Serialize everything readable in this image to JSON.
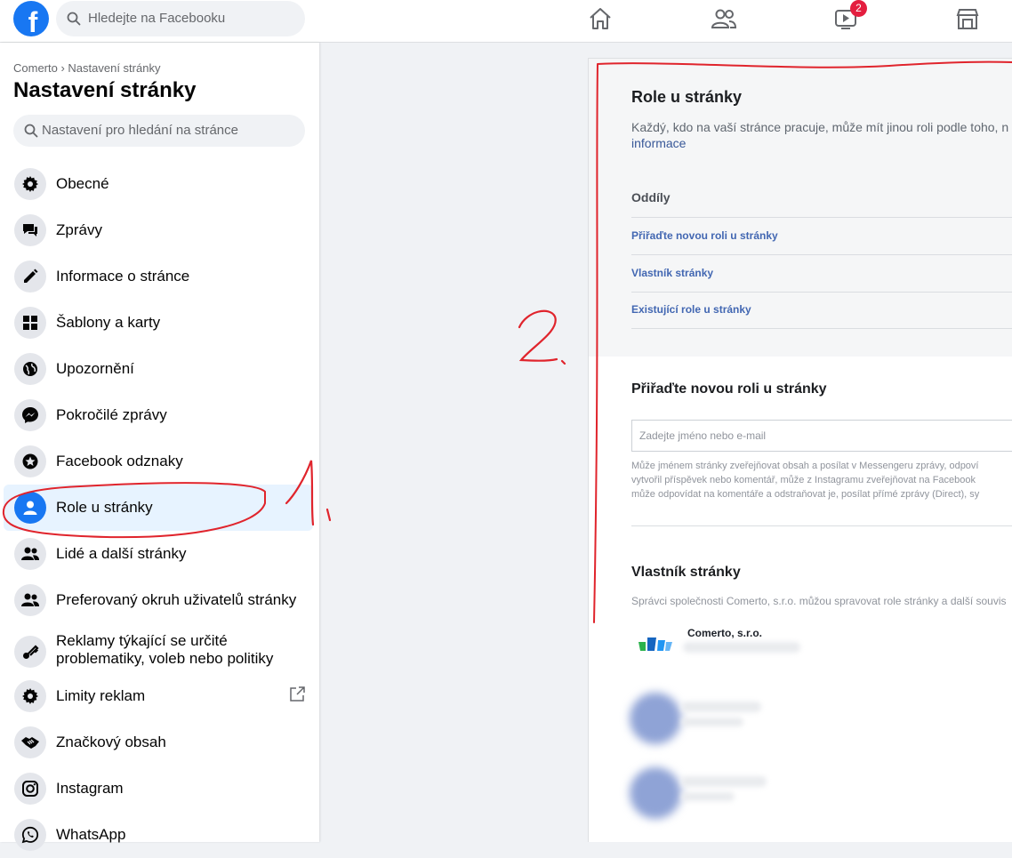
{
  "topbar": {
    "logo": "f",
    "search_placeholder": "Hledejte na Facebooku",
    "nav": [
      {
        "icon": "home-icon"
      },
      {
        "icon": "friends-icon"
      },
      {
        "icon": "watch-icon",
        "badge": "2"
      },
      {
        "icon": "marketplace-icon"
      }
    ]
  },
  "sidebar": {
    "breadcrumb": "Comerto › Nastavení stránky",
    "title": "Nastavení stránky",
    "search_placeholder": "Nastavení pro hledání na stránce",
    "items": [
      {
        "label": "Obecné",
        "icon": "gear-icon"
      },
      {
        "label": "Zprávy",
        "icon": "chat-icon"
      },
      {
        "label": "Informace o stránce",
        "icon": "pencil-icon"
      },
      {
        "label": "Šablony a karty",
        "icon": "grid-icon"
      },
      {
        "label": "Upozornění",
        "icon": "globe-icon"
      },
      {
        "label": "Pokročilé zprávy",
        "icon": "messenger-icon"
      },
      {
        "label": "Facebook odznaky",
        "icon": "star-badge-icon"
      },
      {
        "label": "Role u stránky",
        "icon": "user-icon",
        "active": true
      },
      {
        "label": "Lidé a další stránky",
        "icon": "people-icon"
      },
      {
        "label": "Preferovaný okruh uživatelů stránky",
        "icon": "people-icon"
      },
      {
        "label_line1": "Reklamy týkající se určité",
        "label_line2": "problematiky, voleb nebo politiky",
        "icon": "key-icon"
      },
      {
        "label": "Limity reklam",
        "icon": "gear-icon",
        "external": true
      },
      {
        "label": "Značkový obsah",
        "icon": "handshake-icon"
      },
      {
        "label": "Instagram",
        "icon": "instagram-icon"
      },
      {
        "label": "WhatsApp",
        "icon": "whatsapp-icon"
      }
    ]
  },
  "main": {
    "roles_title": "Role u stránky",
    "roles_desc": "Každý, kdo na vaší stránce pracuje, může mít jinou roli podle toho, n",
    "roles_link": "informace",
    "sections_title": "Oddíly",
    "sections": [
      "Přiřaďte novou roli u stránky",
      "Vlastník stránky",
      "Existující role u stránky"
    ],
    "assign_title": "Přiřaďte novou roli u stránky",
    "assign_placeholder": "Zadejte jméno nebo e-mail",
    "assign_help": [
      "Může jménem stránky zveřejňovat obsah a posílat v Messengeru zprávy, odpoví",
      "vytvořil příspěvek nebo komentář, může z Instagramu zveřejňovat na Facebook",
      "může odpovídat na komentáře a odstraňovat je, posílat přímé zprávy (Direct), sy"
    ],
    "owner_title": "Vlastník stránky",
    "owner_desc": "Správci společnosti Comerto, s.r.o. můžou spravovat role stránky a další souvis",
    "owner_name": "Comerto, s.r.o."
  },
  "annotations": {
    "marker1": "1.",
    "marker2": "2.",
    "color": "#e0242c"
  }
}
